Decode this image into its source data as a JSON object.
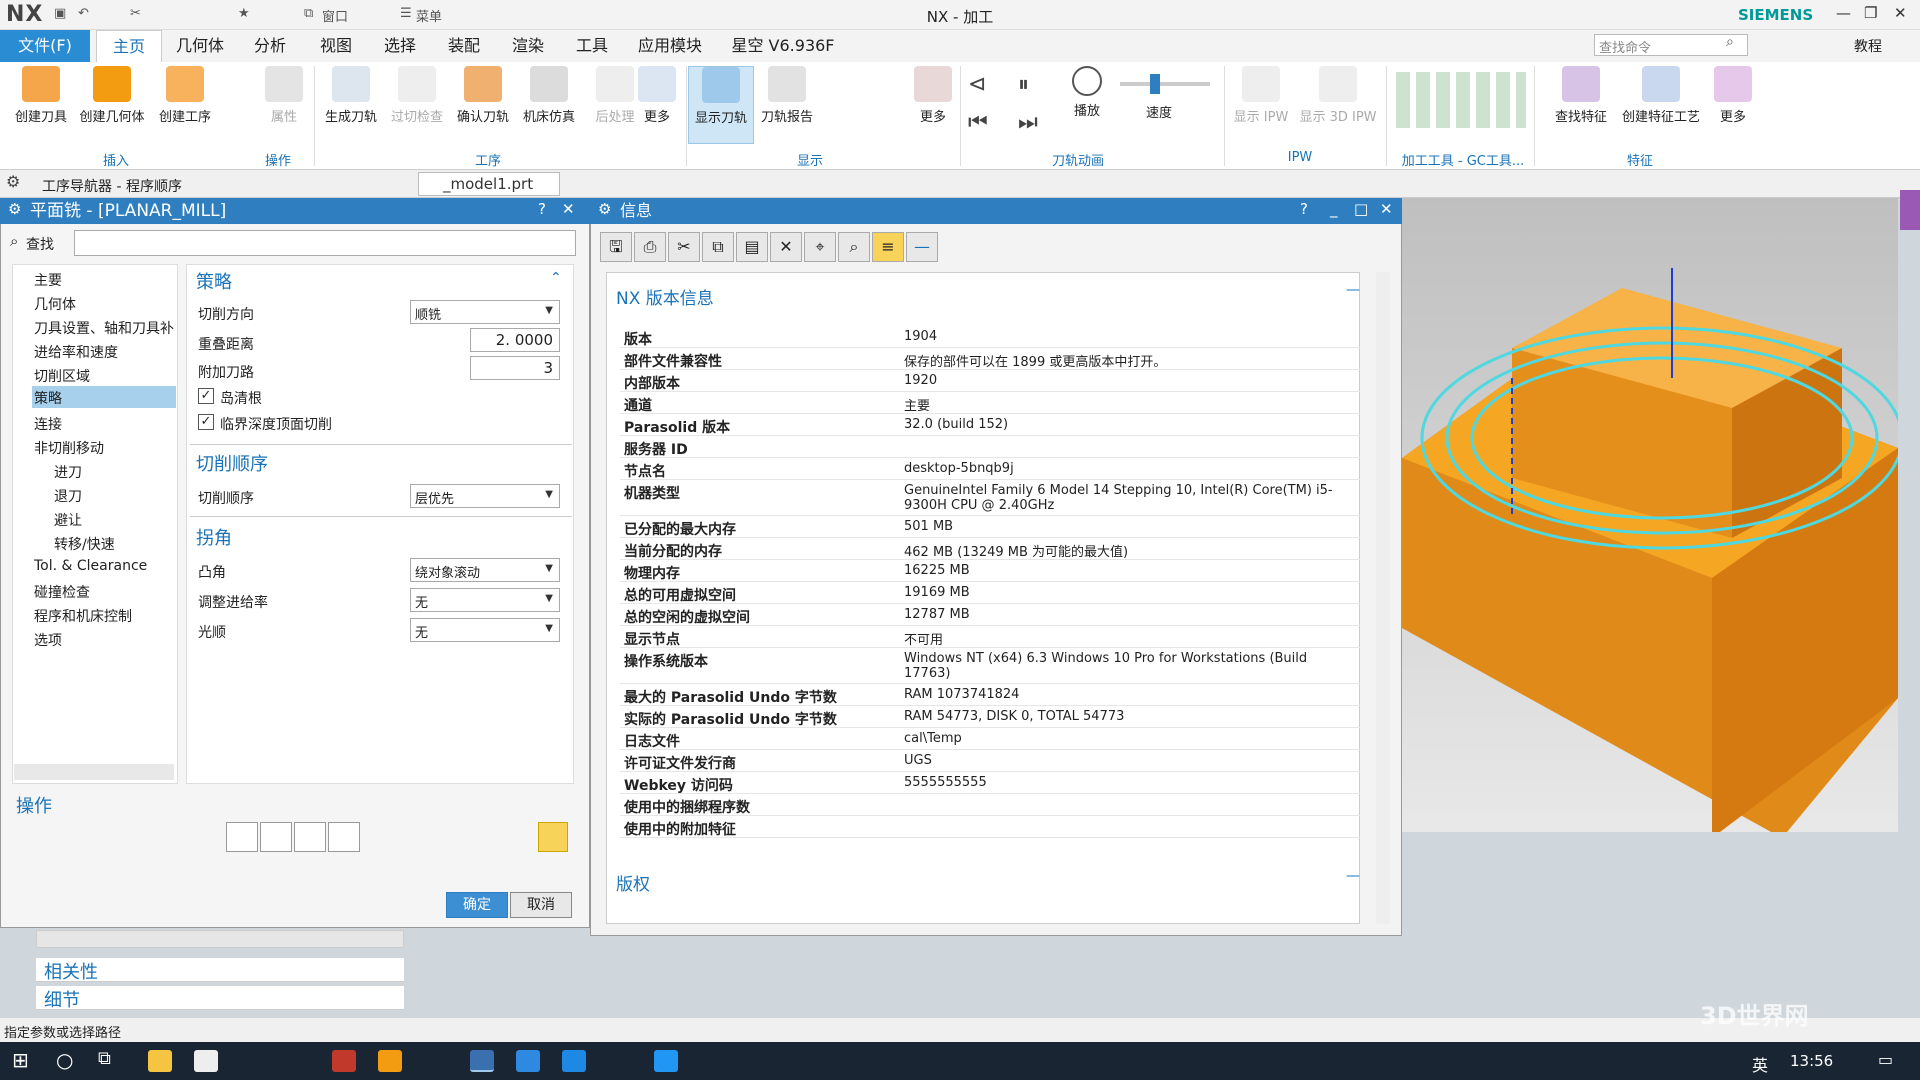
{
  "app": {
    "logo": "NX",
    "title": "NX - 加工",
    "brand": "SIEMENS",
    "quick_menu": "窗口",
    "menu_label": "菜单"
  },
  "menus": [
    "文件(F)",
    "主页",
    "几何体",
    "分析",
    "视图",
    "选择",
    "装配",
    "渲染",
    "工具",
    "应用模块",
    "星空 V6.936F"
  ],
  "search_placeholder": "查找命令",
  "tutorial": "教程",
  "ribbon": {
    "insert": [
      "创建刀具",
      "创建几何体",
      "创建工序"
    ],
    "attr": "属性",
    "process": [
      "生成刀轨",
      "过切检查",
      "确认刀轨",
      "机床仿真",
      "后处理",
      "更多"
    ],
    "display": [
      "显示刀轨",
      "刀轨报告",
      "更多"
    ],
    "animation": [
      "播放",
      "速度"
    ],
    "ipw": [
      "显示 IPW",
      "显示 3D IPW"
    ],
    "feature": [
      "查找特征",
      "创建特征工艺",
      "更多"
    ],
    "groups": [
      "插入",
      "操作",
      "工序",
      "显示",
      "刀轨动画",
      "IPW",
      "加工工具 - GC工具...",
      "特征"
    ]
  },
  "nav_tab": "工序导航器 - 程序顺序",
  "file_tab": "_model1.prt",
  "dialog": {
    "title": "平面铣 - [PLANAR_MILL]",
    "find_label": "查找",
    "tree": [
      "主要",
      "几何体",
      "刀具设置、轴和刀具补",
      "进给率和速度",
      "切削区域",
      "策略",
      "连接",
      "非切削移动",
      "进刀",
      "退刀",
      "避让",
      "转移/快速",
      "Tol. & Clearance",
      "碰撞检查",
      "程序和机床控制",
      "选项"
    ],
    "strategy": {
      "header": "策略",
      "cut_dir_label": "切削方向",
      "cut_dir": "顺铣",
      "overlap_label": "重叠距离",
      "overlap": "2. 0000",
      "extra_label": "附加刀路",
      "extra": "3",
      "island": "岛清根",
      "critical": "临界深度顶面切削"
    },
    "order": {
      "header": "切削顺序",
      "label": "切削顺序",
      "value": "层优先"
    },
    "corner": {
      "header": "拐角",
      "convex_label": "凸角",
      "convex": "绕对象滚动",
      "feed_label": "调整进给率",
      "feed": "无",
      "smooth_label": "光顺",
      "smooth": "无"
    },
    "ops_header": "操作",
    "ok": "确定",
    "cancel": "取消"
  },
  "lower_nav": [
    "相关性",
    "细节"
  ],
  "info": {
    "title": "信息",
    "section": "NX 版本信息",
    "rows": [
      [
        "版本",
        "1904"
      ],
      [
        "部件文件兼容性",
        "保存的部件可以在 1899 或更高版本中打开。"
      ],
      [
        "内部版本",
        "1920"
      ],
      [
        "通道",
        "主要"
      ],
      [
        "Parasolid 版本",
        "32.0 (build 152)"
      ],
      [
        "服务器 ID",
        ""
      ],
      [
        "节点名",
        "desktop-5bnqb9j"
      ],
      [
        "机器类型",
        "GenuineIntel Family 6 Model 14 Stepping 10, Intel(R) Core(TM) i5-9300H CPU @ 2.40GHz"
      ],
      [
        "已分配的最大内存",
        "501 MB"
      ],
      [
        "当前分配的内存",
        "462 MB (13249 MB 为可能的最大值)"
      ],
      [
        "物理内存",
        "16225 MB"
      ],
      [
        "总的可用虚拟空间",
        "19169 MB"
      ],
      [
        "总的空闲的虚拟空间",
        "12787 MB"
      ],
      [
        "显示节点",
        "不可用"
      ],
      [
        "操作系统版本",
        "Windows NT (x64) 6.3 Windows 10 Pro for Workstations (Build 17763)"
      ],
      [
        "最大的 Parasolid Undo 字节数",
        "RAM 1073741824"
      ],
      [
        "实际的 Parasolid Undo 字节数",
        "RAM 54773, DISK 0, TOTAL 54773"
      ],
      [
        "日志文件",
        "cal\\Temp"
      ],
      [
        "许可证文件发行商",
        "UGS"
      ],
      [
        "Webkey 访问码",
        "5555555555"
      ],
      [
        "使用中的捆绑程序数",
        ""
      ],
      [
        "使用中的附加特征",
        ""
      ]
    ],
    "section2": "版权"
  },
  "status_text": "指定参数或选择路径",
  "clock": "13:56",
  "ime": "英",
  "watermark": "3D世界网",
  "colors": {
    "accent": "#2f7fc0",
    "file_tab": "#2a8dd4",
    "part": "#f39c12",
    "toolpath": "#4fd8e0"
  }
}
